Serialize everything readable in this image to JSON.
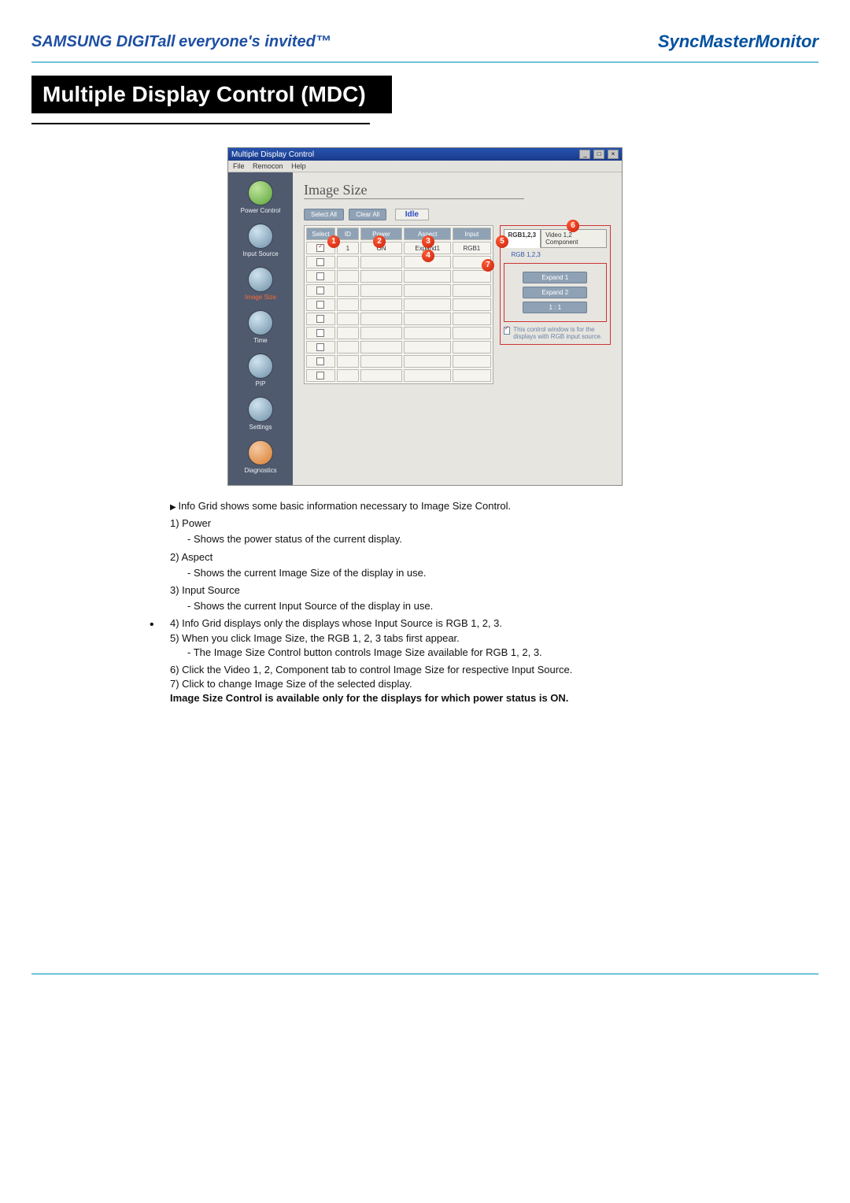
{
  "header": {
    "logo_left": "SAMSUNG DIGITall",
    "tagline": "everyone's invited™",
    "logo_right": "SyncMaster",
    "logo_right_sub": "Monitor"
  },
  "title": "Multiple Display Control (MDC)",
  "app": {
    "window_title": "Multiple Display Control",
    "menubar": {
      "file": "File",
      "remocon": "Remocon",
      "help": "Help"
    },
    "sidebar": {
      "items": [
        {
          "label": "Power Control"
        },
        {
          "label": "Input Source"
        },
        {
          "label": "Image Size"
        },
        {
          "label": "Time"
        },
        {
          "label": "PIP"
        },
        {
          "label": "Settings"
        },
        {
          "label": "Diagnostics"
        }
      ]
    },
    "panel_title": "Image Size",
    "buttons": {
      "select_all": "Select All",
      "clear_all": "Clear All",
      "idle": "Idle"
    },
    "grid": {
      "headers": {
        "select": "Select",
        "id": "ID",
        "power": "Power",
        "aspect": "Aspect",
        "input": "Input"
      },
      "row1": {
        "id": "1",
        "power": "ON",
        "aspect": "Expand1",
        "input": "RGB1"
      }
    },
    "control": {
      "tab_rgb": "RGB1,2,3",
      "tab_video": "Video 1,2 Component",
      "dropdown_label": "RGB 1,2,3",
      "btn_expand1": "Expand 1",
      "btn_expand2": "Expand 2",
      "btn_11": "1 : 1",
      "note": "This control window is for the displays with RGB input source."
    },
    "callouts": {
      "c1": "1",
      "c2": "2",
      "c3": "3",
      "c4": "4",
      "c5": "5",
      "c6": "6",
      "c7": "7"
    }
  },
  "desc": {
    "intro": "Info Grid shows some basic information necessary to Image Size Control.",
    "n1": "1) Power",
    "d1": "Shows the power status of the current display.",
    "n2": "2) Aspect",
    "d2": "Shows the current Image Size of the display in use.",
    "n3": "3) Input Source",
    "d3": "Shows the current Input Source of the display in use.",
    "n4": "4) Info Grid displays only the displays whose Input Source is RGB 1, 2, 3.",
    "n5": "5) When you click Image Size, the RGB 1, 2, 3 tabs first appear.",
    "d5": "The Image Size Control button controls Image Size available for RGB 1, 2, 3.",
    "n6": "6) Click the Video 1, 2, Component tab to control Image Size for respective Input Source.",
    "n7": "7) Click to change Image Size of the selected display.",
    "bold": "Image Size Control is available only for the displays for which power status is ON."
  }
}
